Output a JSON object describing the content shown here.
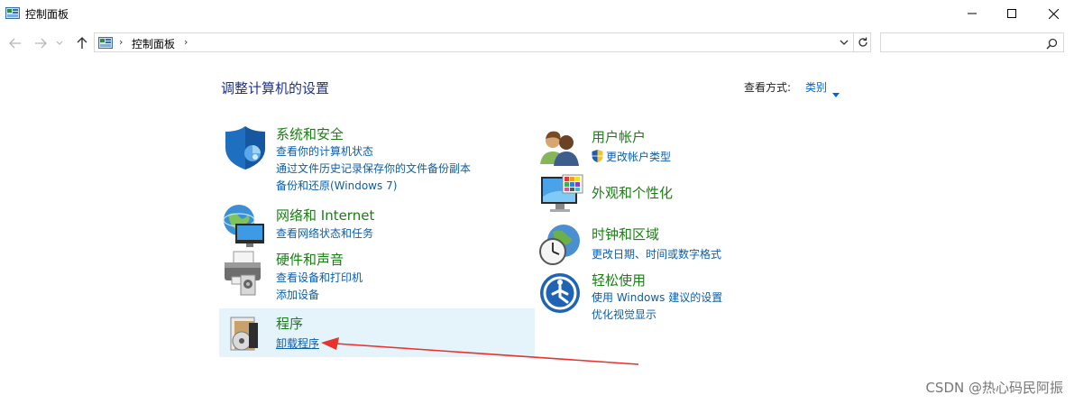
{
  "window": {
    "title": "控制面板"
  },
  "address": {
    "path_item": "控制面板",
    "search_placeholder": ""
  },
  "main": {
    "heading": "调整计算机的设置",
    "view_by_label": "查看方式:",
    "view_by_value": "类别"
  },
  "categories": {
    "system": {
      "title": "系统和安全",
      "links": [
        "查看你的计算机状态",
        "通过文件历史记录保存你的文件备份副本",
        "备份和还原(Windows 7)"
      ]
    },
    "network": {
      "title": "网络和 Internet",
      "links": [
        "查看网络状态和任务"
      ]
    },
    "hardware": {
      "title": "硬件和声音",
      "links": [
        "查看设备和打印机",
        "添加设备"
      ]
    },
    "programs": {
      "title": "程序",
      "links": [
        "卸载程序"
      ]
    },
    "user": {
      "title": "用户帐户",
      "links": [
        "更改帐户类型"
      ]
    },
    "appearance": {
      "title": "外观和个性化",
      "links": []
    },
    "clock": {
      "title": "时钟和区域",
      "links": [
        "更改日期、时间或数字格式"
      ]
    },
    "ease": {
      "title": "轻松使用",
      "links": [
        "使用 Windows 建议的设置",
        "优化视觉显示"
      ]
    }
  },
  "watermark": "CSDN @热心码民阿振",
  "colors": {
    "heading": "#1e3287",
    "category_title": "#1a7f14",
    "link": "#0b5ea8",
    "highlight": "#e5f3fb",
    "arrow": "#e8322b"
  }
}
